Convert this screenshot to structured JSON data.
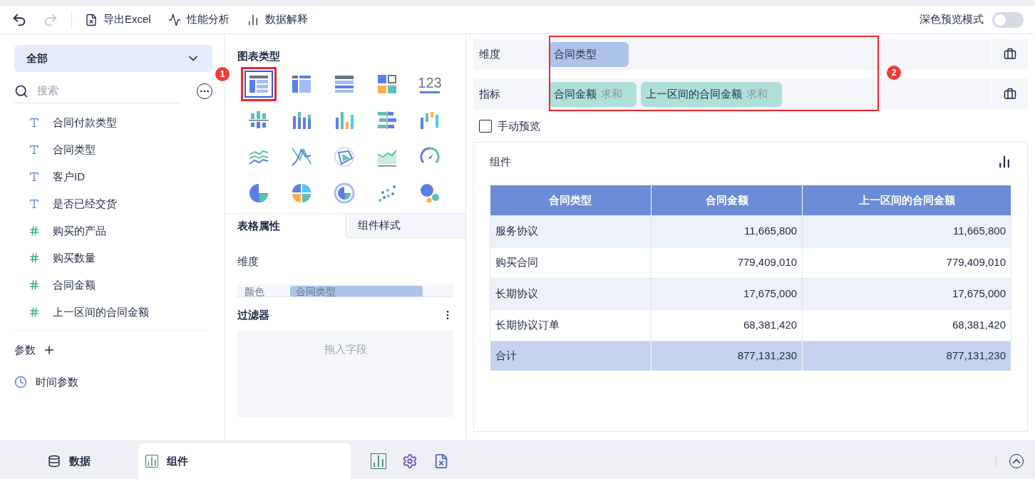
{
  "toolbar": {
    "buttons": [
      {
        "label": "导出Excel",
        "kind": "excel"
      },
      {
        "label": "性能分析",
        "kind": "perf"
      },
      {
        "label": "数据解释",
        "kind": "explain"
      }
    ],
    "dark_preview": {
      "label": "深色预览模式",
      "on": false
    }
  },
  "data_panel": {
    "dataset": "全部",
    "search": {
      "placeholder": "搜索"
    },
    "fields": [
      {
        "name": "合同付款类型",
        "kind": "text"
      },
      {
        "name": "合同类型",
        "kind": "text"
      },
      {
        "name": "客户ID",
        "kind": "text"
      },
      {
        "name": "是否已经交货",
        "kind": "text"
      },
      {
        "name": "购买的产品",
        "kind": "number"
      },
      {
        "name": "购买数量",
        "kind": "number"
      },
      {
        "name": "合同金额",
        "kind": "number"
      },
      {
        "name": "上一区间的合同金额",
        "kind": "number"
      }
    ],
    "params_label": "参数",
    "params": [
      {
        "label": "时间参数"
      }
    ]
  },
  "chart_types": {
    "title": "图表类型",
    "annotation": "1",
    "items": [
      {
        "selected": true
      },
      {
        "selected": false
      },
      {
        "selected": false
      },
      {
        "selected": false
      },
      {
        "selected": false,
        "label": "123"
      },
      {
        "selected": false
      },
      {
        "selected": false
      },
      {
        "selected": false
      },
      {
        "selected": false
      },
      {
        "selected": false
      },
      {
        "selected": false
      },
      {
        "selected": false
      },
      {
        "selected": false
      },
      {
        "selected": false
      },
      {
        "selected": false
      },
      {
        "selected": false
      },
      {
        "selected": false
      },
      {
        "selected": false
      },
      {
        "selected": false
      },
      {
        "selected": false
      }
    ]
  },
  "properties": {
    "tabs": [
      {
        "label": "表格属性",
        "selected": true
      },
      {
        "label": "组件样式",
        "selected": false
      }
    ],
    "section": "维度",
    "color_row": {
      "label": "颜色",
      "value": "合同类型"
    }
  },
  "filter": {
    "title": "过滤器",
    "placeholder": "拖入字段"
  },
  "shelves": {
    "annotation": "2",
    "rows": [
      {
        "label": "维度",
        "pills": [
          {
            "name": "合同类型",
            "kind": "dimension"
          }
        ]
      },
      {
        "label": "指标",
        "pills": [
          {
            "name": "合同金额",
            "agg": "求和",
            "kind": "measure"
          },
          {
            "name": "上一区间的合同金额",
            "agg": "求和",
            "kind": "measure"
          }
        ]
      }
    ]
  },
  "manual_preview": {
    "label": "手动预览",
    "checked": false
  },
  "component": {
    "title": "组件",
    "table": {
      "columns": [
        "合同类型",
        "合同金额",
        "上一区间的合同金额"
      ],
      "rows": [
        [
          "服务协议",
          "11,665,800",
          "11,665,800"
        ],
        [
          "购买合同",
          "779,409,010",
          "779,409,010"
        ],
        [
          "长期协议",
          "17,675,000",
          "17,675,000"
        ],
        [
          "长期协议订单",
          "68,381,420",
          "68,381,420"
        ]
      ],
      "total": [
        "合计",
        "877,131,230",
        "877,131,230"
      ]
    }
  },
  "bottom_tabs": [
    {
      "label": "数据",
      "selected": false,
      "kind": "data"
    },
    {
      "label": "组件",
      "selected": true,
      "kind": "component"
    }
  ]
}
